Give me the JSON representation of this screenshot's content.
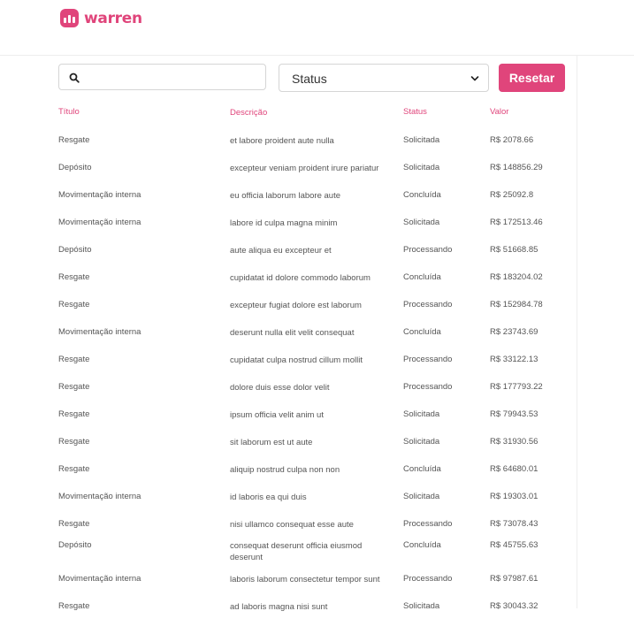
{
  "brand": {
    "name": "warren",
    "color": "#e0457b"
  },
  "filters": {
    "search_value": "",
    "status_label": "Status",
    "reset_label": "Resetar"
  },
  "table": {
    "headers": [
      "Título",
      "Descrição",
      "Status",
      "Valor"
    ],
    "rows": [
      {
        "title": "Resgate",
        "description": "et labore proident aute nulla",
        "status": "Solicitada",
        "value": "R$ 2078.66"
      },
      {
        "title": "Depósito",
        "description": "excepteur veniam proident irure pariatur",
        "status": "Solicitada",
        "value": "R$ 148856.29"
      },
      {
        "title": "Movimentação interna",
        "description": "eu officia laborum labore aute",
        "status": "Concluída",
        "value": "R$ 25092.8"
      },
      {
        "title": "Movimentação interna",
        "description": "labore id culpa magna minim",
        "status": "Solicitada",
        "value": "R$ 172513.46"
      },
      {
        "title": "Depósito",
        "description": "aute aliqua eu excepteur et",
        "status": "Processando",
        "value": "R$ 51668.85"
      },
      {
        "title": "Resgate",
        "description": "cupidatat id dolore commodo laborum",
        "status": "Concluída",
        "value": "R$ 183204.02"
      },
      {
        "title": "Resgate",
        "description": "excepteur fugiat dolore est laborum",
        "status": "Processando",
        "value": "R$ 152984.78"
      },
      {
        "title": "Movimentação interna",
        "description": "deserunt nulla elit velit consequat",
        "status": "Concluída",
        "value": "R$ 23743.69"
      },
      {
        "title": "Resgate",
        "description": "cupidatat culpa nostrud cillum mollit",
        "status": "Processando",
        "value": "R$ 33122.13"
      },
      {
        "title": "Resgate",
        "description": "dolore duis esse dolor velit",
        "status": "Processando",
        "value": "R$ 177793.22"
      },
      {
        "title": "Resgate",
        "description": "ipsum officia velit anim ut",
        "status": "Solicitada",
        "value": "R$ 79943.53"
      },
      {
        "title": "Resgate",
        "description": "sit laborum est ut aute",
        "status": "Solicitada",
        "value": "R$ 31930.56"
      },
      {
        "title": "Resgate",
        "description": "aliquip nostrud culpa non non",
        "status": "Concluída",
        "value": "R$ 64680.01"
      },
      {
        "title": "Movimentação interna",
        "description": "id laboris ea qui duis",
        "status": "Solicitada",
        "value": "R$ 19303.01"
      },
      {
        "title": "Resgate",
        "description": "nisi ullamco consequat esse aute",
        "status": "Processando",
        "value": "R$ 73078.43"
      },
      {
        "title": "Depósito",
        "description": "consequat deserunt officia eiusmod deserunt",
        "status": "Concluída",
        "value": "R$ 45755.63"
      },
      {
        "title": "Movimentação interna",
        "description": "laboris laborum consectetur tempor sunt",
        "status": "Processando",
        "value": "R$ 97987.61"
      },
      {
        "title": "Resgate",
        "description": "ad laboris magna nisi sunt",
        "status": "Solicitada",
        "value": "R$ 30043.32"
      }
    ]
  }
}
